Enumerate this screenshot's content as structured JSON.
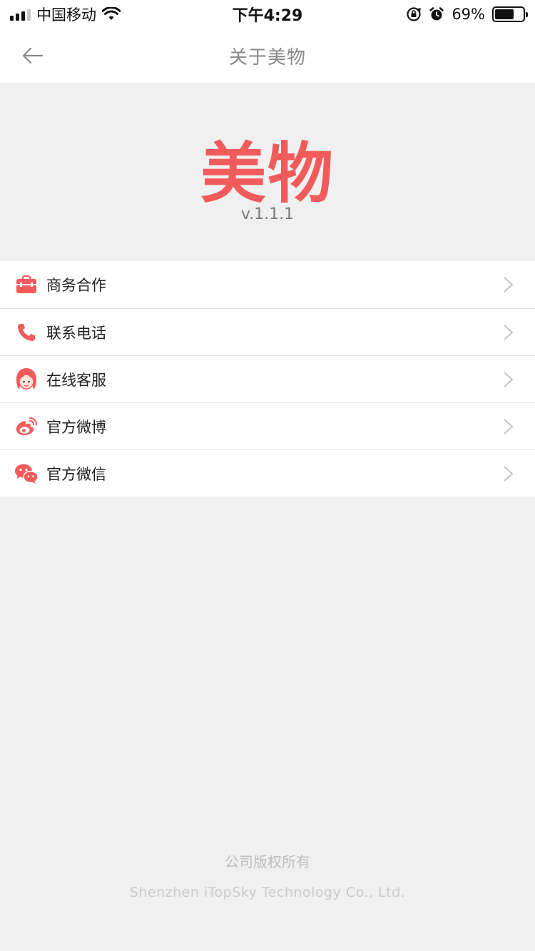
{
  "status_bar": {
    "carrier": "中国移动",
    "time": "下午4:29",
    "battery_percent": "69%",
    "battery_level": 0.69,
    "icons": [
      "signal-icon",
      "wifi-icon",
      "rotation-lock-icon",
      "alarm-icon",
      "battery-icon"
    ]
  },
  "nav": {
    "title": "关于美物",
    "back_icon": "back-arrow-icon"
  },
  "header": {
    "logo": "美物",
    "version": "v.1.1.1"
  },
  "menu": {
    "items": [
      {
        "label": "商务合作",
        "icon": "briefcase-icon"
      },
      {
        "label": "联系电话",
        "icon": "phone-icon"
      },
      {
        "label": "在线客服",
        "icon": "customer-service-icon"
      },
      {
        "label": "官方微博",
        "icon": "weibo-icon"
      },
      {
        "label": "官方微信",
        "icon": "wechat-icon"
      }
    ]
  },
  "footer": {
    "copyright": "公司版权所有",
    "company": "Shenzhen iTopSky Technology Co., Ltd."
  },
  "colors": {
    "accent": "#f25b5b",
    "background": "#f0f0f0",
    "divider": "#e6e6e6"
  }
}
